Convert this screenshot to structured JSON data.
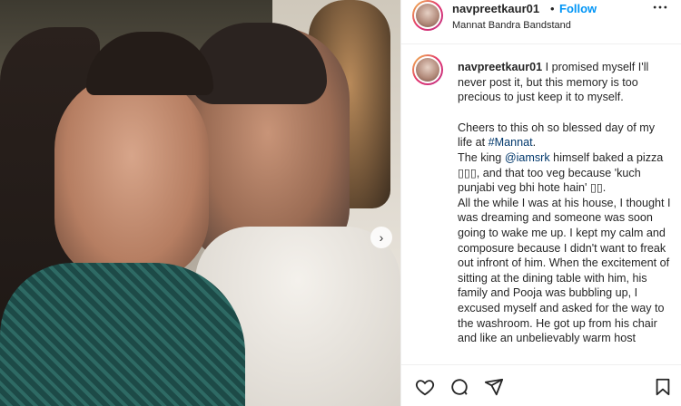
{
  "header": {
    "username": "navpreetkaur01",
    "separator": "•",
    "follow_label": "Follow",
    "location": "Mannat Bandra Bandstand",
    "more_icon": "more-horizontal-icon"
  },
  "photo": {
    "next_icon": "chevron-right-icon",
    "next_glyph": "›"
  },
  "caption": {
    "username": "navpreetkaur01",
    "intro": " I promised myself I'll never post it, but this memory is too precious to just keep it to myself.",
    "cheers_before": "Cheers to this oh so blessed day of my life at ",
    "cheers_tag": "#Mannat",
    "cheers_after": ".",
    "king_before": "The king ",
    "king_mention": "@iamsrk",
    "king_after": " himself baked a pizza ▯▯▯, and that too veg because 'kuch punjabi veg bhi hote hain' ▯▯.",
    "rest": "All the while I was at his house, I thought I was dreaming and someone was soon going to wake me up. I kept my calm and composure because I didn't want to freak out infront of him. When the excitement of sitting at the dining table with him, his family and Pooja was bubbling up, I excused myself and asked for the way to the washroom. He got up from his chair and like an unbelievably warm host"
  },
  "actions": {
    "like_icon": "heart-icon",
    "comment_icon": "comment-icon",
    "share_icon": "send-icon",
    "save_icon": "bookmark-icon"
  },
  "colors": {
    "follow": "#0095f6",
    "text": "#262626",
    "link": "#00376b",
    "border": "#efefef"
  }
}
